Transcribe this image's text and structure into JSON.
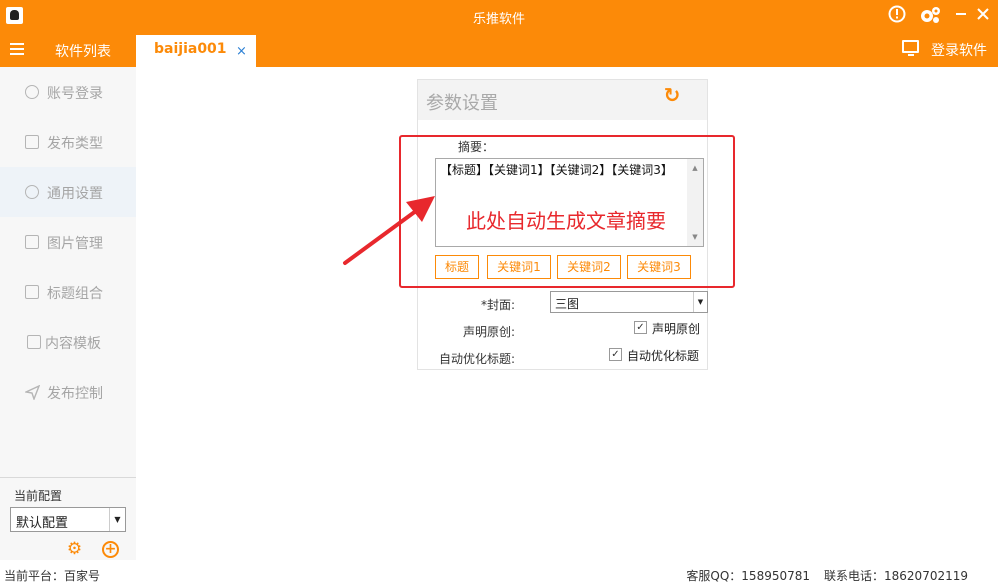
{
  "window": {
    "title": "乐推软件"
  },
  "tabbar": {
    "list_label": "软件列表",
    "active_tab": "baijia001",
    "close_glyph": "×",
    "login_label": "登录软件"
  },
  "sidebar": {
    "items": [
      {
        "label": "账号登录",
        "icon": "user-icon"
      },
      {
        "label": "发布类型",
        "icon": "list-icon"
      },
      {
        "label": "通用设置",
        "icon": "gear-icon"
      },
      {
        "label": "图片管理",
        "icon": "image-icon"
      },
      {
        "label": "标题组合",
        "icon": "document-icon"
      },
      {
        "label": "内容模板",
        "icon": "template-icon"
      },
      {
        "label": "发布控制",
        "icon": "send-icon"
      }
    ],
    "current_config_label": "当前配置",
    "current_config_value": "默认配置"
  },
  "panel": {
    "title": "参数设置",
    "summary_label": "摘要：",
    "summary_value": "【标题】【关键词1】【关键词2】【关键词3】",
    "insert_buttons": [
      "标题",
      "关键词1",
      "关键词2",
      "关键词3"
    ],
    "cover_label": "*封面:",
    "cover_value": "三图",
    "declare_label": "声明原创:",
    "declare_checkbox_label": "声明原创",
    "optimize_label": "自动优化标题:",
    "optimize_checkbox_label": "自动优化标题"
  },
  "annotation": {
    "text": "此处自动生成文章摘要",
    "color": "#e8282d"
  },
  "footer": {
    "platform": "当前平台：百家号",
    "qq": "客服QQ：158950781",
    "phone": "联系电话：18620702119"
  },
  "colors": {
    "accent": "#fc8a08",
    "sidebar_bg": "#f7f7f7",
    "active_item_bg": "#eef3f8"
  }
}
